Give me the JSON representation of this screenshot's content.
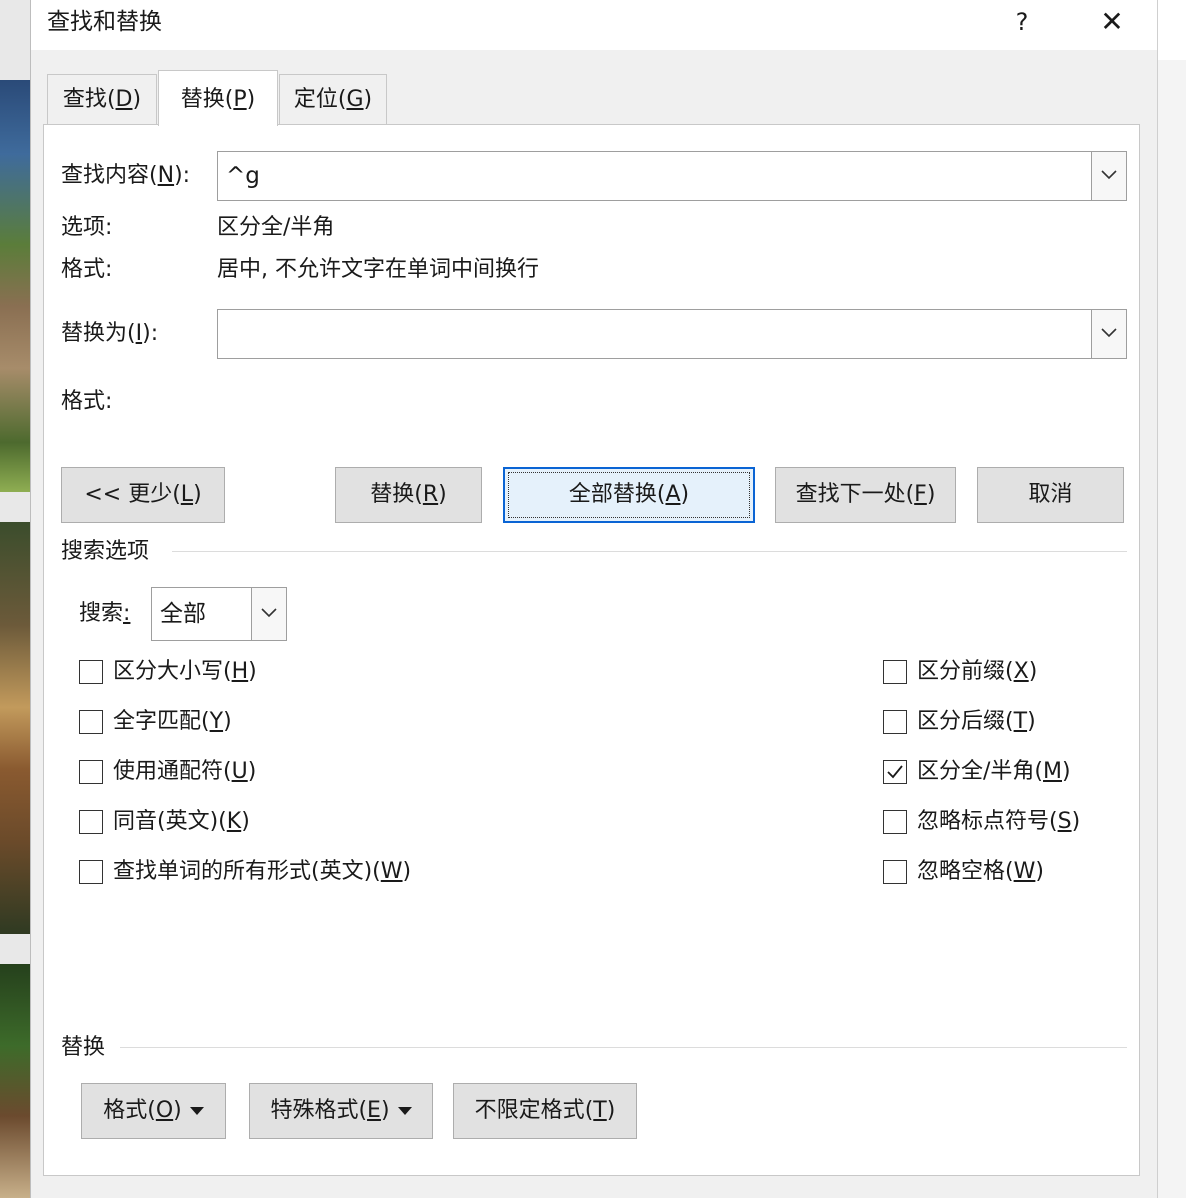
{
  "dialog": {
    "title": "查找和替换",
    "help": "?",
    "close": "✕"
  },
  "tabs": [
    {
      "label": "查找",
      "key": "D",
      "active": false
    },
    {
      "label": "替换",
      "key": "P",
      "active": true
    },
    {
      "label": "定位",
      "key": "G",
      "active": false
    }
  ],
  "find": {
    "label": "查找内容",
    "key": "N",
    "value": "^g",
    "options_label": "选项:",
    "options_value": "区分全/半角",
    "format_label": "格式:",
    "format_value": "居中, 不允许文字在单词中间换行"
  },
  "replace": {
    "label": "替换为",
    "key": "I",
    "value": "",
    "format_label": "格式:"
  },
  "buttons": {
    "less": {
      "label": "<< 更少",
      "key": "L"
    },
    "replace": {
      "label": "替换",
      "key": "R"
    },
    "replace_all": {
      "label": "全部替换",
      "key": "A"
    },
    "find_next": {
      "label": "查找下一处",
      "key": "F"
    },
    "cancel": "取消"
  },
  "search_options": {
    "group_label": "搜索选项",
    "search_label": "搜索",
    "search_key": "",
    "search_value": "全部",
    "left": [
      {
        "label": "区分大小写",
        "key": "H",
        "checked": false
      },
      {
        "label": "全字匹配",
        "key": "Y",
        "checked": false
      },
      {
        "label": "使用通配符",
        "key": "U",
        "checked": false
      },
      {
        "label": "同音(英文)",
        "key": "K",
        "checked": false
      },
      {
        "label": "查找单词的所有形式(英文)",
        "key": "W",
        "checked": false
      }
    ],
    "right": [
      {
        "label": "区分前缀",
        "key": "X",
        "checked": false
      },
      {
        "label": "区分后缀",
        "key": "T",
        "checked": false
      },
      {
        "label": "区分全/半角",
        "key": "M",
        "checked": true
      },
      {
        "label": "忽略标点符号",
        "key": "S",
        "checked": false
      },
      {
        "label": "忽略空格",
        "key": "W",
        "checked": false
      }
    ]
  },
  "replace_group": {
    "group_label": "替换",
    "format_btn": {
      "label": "格式",
      "key": "O"
    },
    "special_btn": {
      "label": "特殊格式",
      "key": "E"
    },
    "no_format_btn": {
      "label": "不限定格式",
      "key": "T"
    }
  }
}
